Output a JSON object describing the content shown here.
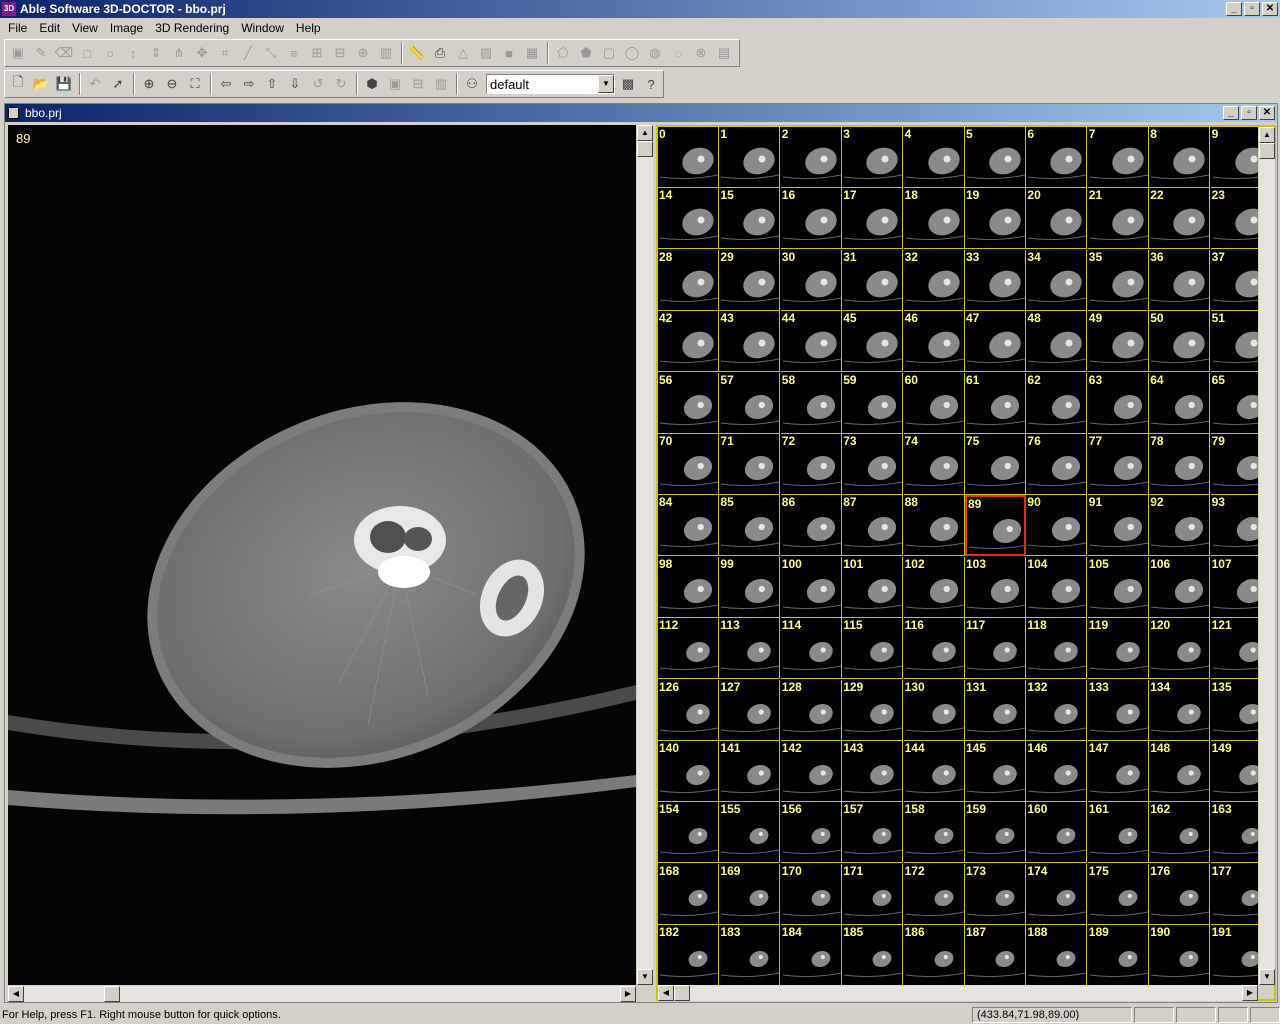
{
  "window": {
    "title": "Able Software 3D-DOCTOR - bbo.prj",
    "minimize": "_",
    "restore": "▫",
    "close": "✕"
  },
  "menu": [
    "File",
    "Edit",
    "View",
    "Image",
    "3D Rendering",
    "Window",
    "Help"
  ],
  "toolbar1": {
    "icons": [
      "select-region-icon",
      "draw-polyline-icon",
      "eraser-icon",
      "rectangle-icon",
      "ellipse-icon",
      "split-vertical-icon",
      "merge-vertical-icon",
      "branch-icon",
      "move-points-icon",
      "crop-icon",
      "line-tool-icon",
      "resize-icon",
      "align-icon",
      "grid-icon",
      "ortho-icon",
      "crosshair-icon",
      "histogram-icon",
      "ruler-icon",
      "print-icon",
      "triangle-icon",
      "picture-icon",
      "fill-icon",
      "table-icon",
      "polygon-edit-icon",
      "pentagon-icon",
      "square-icon",
      "circle-icon",
      "blob-icon",
      "smooth-icon",
      "delete-object-icon",
      "multi-slice-icon"
    ]
  },
  "toolbar2": {
    "icons": [
      "new-file-icon",
      "open-folder-icon",
      "save-icon",
      "undo-icon",
      "pointer-icon",
      "zoom-in-icon",
      "zoom-out-icon",
      "fit-view-icon",
      "arrow-left-icon",
      "arrow-right-icon",
      "arrow-up-icon",
      "arrow-down-icon",
      "rotate-ccw-icon",
      "rotate-cw-icon",
      "volume-render-icon",
      "frame-icon",
      "slice-icon",
      "film-strip-icon",
      "network-icon"
    ],
    "profile": "default",
    "after": [
      "palette-icon",
      "help-context-icon"
    ]
  },
  "document": {
    "title": "bbo.prj",
    "minimize": "_",
    "restore": "▫",
    "close": "✕"
  },
  "main_view": {
    "slice_label": "89"
  },
  "thumbnails": {
    "rows": [
      [
        "0",
        "1",
        "2",
        "3",
        "4",
        "5",
        "6",
        "7",
        "8",
        "9"
      ],
      [
        "14",
        "15",
        "16",
        "17",
        "18",
        "19",
        "20",
        "21",
        "22",
        "23"
      ],
      [
        "28",
        "29",
        "30",
        "31",
        "32",
        "33",
        "34",
        "35",
        "36",
        "37"
      ],
      [
        "42",
        "43",
        "44",
        "45",
        "46",
        "47",
        "48",
        "49",
        "50",
        "51"
      ],
      [
        "56",
        "57",
        "58",
        "59",
        "60",
        "61",
        "62",
        "63",
        "64",
        "65"
      ],
      [
        "70",
        "71",
        "72",
        "73",
        "74",
        "75",
        "76",
        "77",
        "78",
        "79"
      ],
      [
        "84",
        "85",
        "86",
        "87",
        "88",
        "89",
        "90",
        "91",
        "92",
        "93"
      ],
      [
        "98",
        "99",
        "100",
        "101",
        "102",
        "103",
        "104",
        "105",
        "106",
        "107"
      ],
      [
        "112",
        "113",
        "114",
        "115",
        "116",
        "117",
        "118",
        "119",
        "120",
        "121"
      ],
      [
        "126",
        "127",
        "128",
        "129",
        "130",
        "131",
        "132",
        "133",
        "134",
        "135"
      ],
      [
        "140",
        "141",
        "142",
        "143",
        "144",
        "145",
        "146",
        "147",
        "148",
        "149"
      ],
      [
        "154",
        "155",
        "156",
        "157",
        "158",
        "159",
        "160",
        "161",
        "162",
        "163"
      ],
      [
        "168",
        "169",
        "170",
        "171",
        "172",
        "173",
        "174",
        "175",
        "176",
        "177"
      ],
      [
        "182",
        "183",
        "184",
        "185",
        "186",
        "187",
        "188",
        "189",
        "190",
        "191"
      ]
    ],
    "selected": "89",
    "selection_color": "#e03010",
    "grid_color": "#c8c800"
  },
  "status": {
    "help": "For Help, press F1. Right mouse button for quick options.",
    "coords": "(433.84,71.98,89.00)",
    "panels": [
      "",
      "",
      "",
      ""
    ]
  }
}
